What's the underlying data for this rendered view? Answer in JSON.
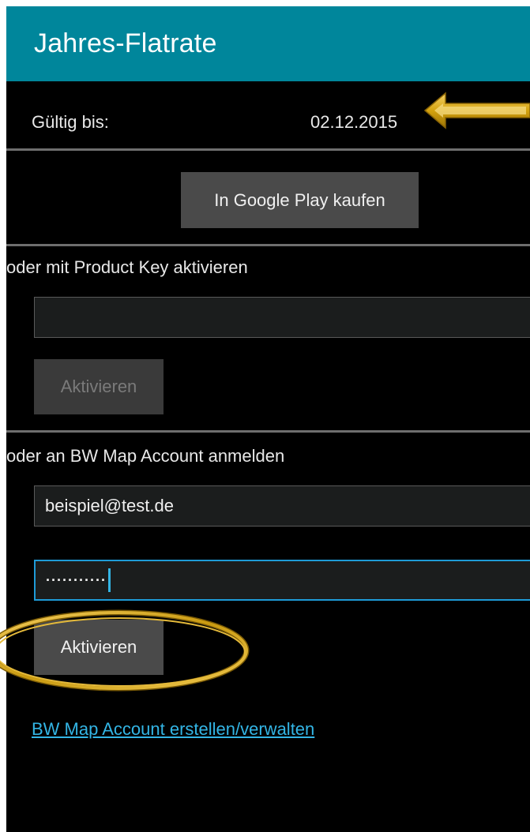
{
  "header": {
    "title": "Jahres-Flatrate"
  },
  "validity": {
    "label": "Gültig bis:",
    "value": "02.12.2015"
  },
  "google_play": {
    "button_label": "In Google Play kaufen"
  },
  "product_key": {
    "section_label": "oder mit Product Key aktivieren",
    "input_value": "",
    "button_label": "Aktivieren",
    "button_enabled": false
  },
  "account": {
    "section_label": "oder an BW Map Account anmelden",
    "email_value": "beispiel@test.de",
    "password_mask": "···········",
    "button_label": "Aktivieren",
    "manage_link": "BW Map Account erstellen/verwalten"
  },
  "colors": {
    "titlebar": "#00869b",
    "background": "#000000",
    "button": "#4a4a4a",
    "link": "#33b5e5",
    "focus_border": "#1e9bd7",
    "annotation_gold": "#d4a20e"
  },
  "annotations": {
    "arrow_icon": "gold-arrow-left-icon",
    "oval_icon": "gold-oval-highlight-icon"
  }
}
